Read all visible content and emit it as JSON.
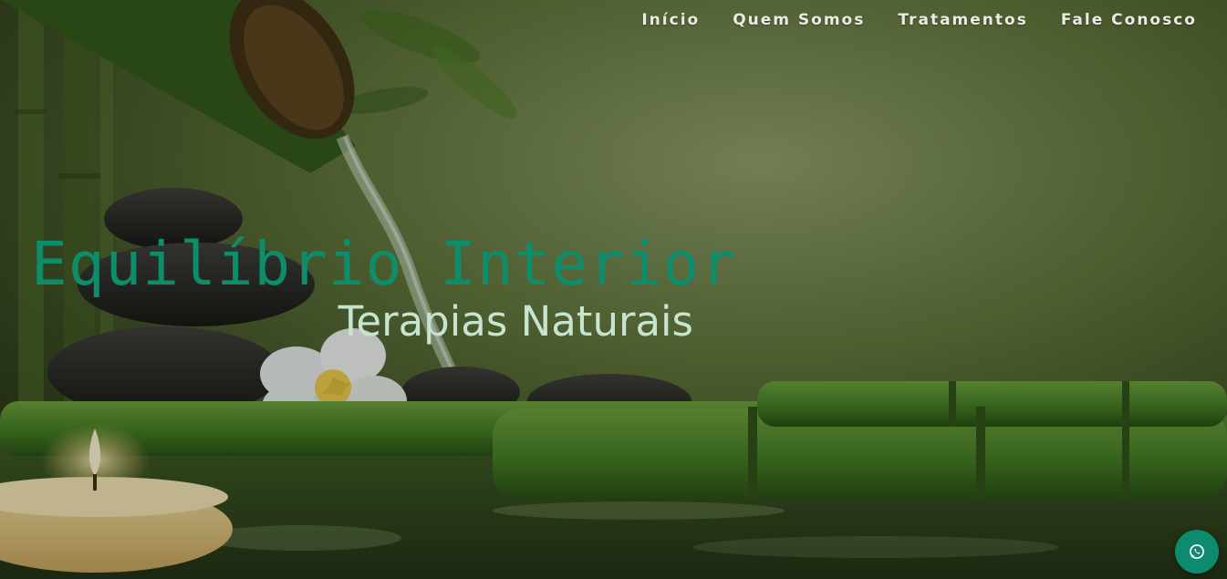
{
  "nav": {
    "items": [
      {
        "label": "Início"
      },
      {
        "label": "Quem Somos"
      },
      {
        "label": "Tratamentos"
      },
      {
        "label": "Fale Conosco"
      }
    ]
  },
  "hero": {
    "title": "Equilíbrio Interior",
    "subtitle": "Terapias Naturais",
    "background_image": "spa-bamboo-water-stones-scene"
  },
  "floating": {
    "icon": "whatsapp-icon"
  },
  "colors": {
    "title": "#0f8d6a",
    "subtitle": "#c7e4cf",
    "nav_text": "#e9ece2",
    "whatsapp_button": "#0c8b6e"
  }
}
